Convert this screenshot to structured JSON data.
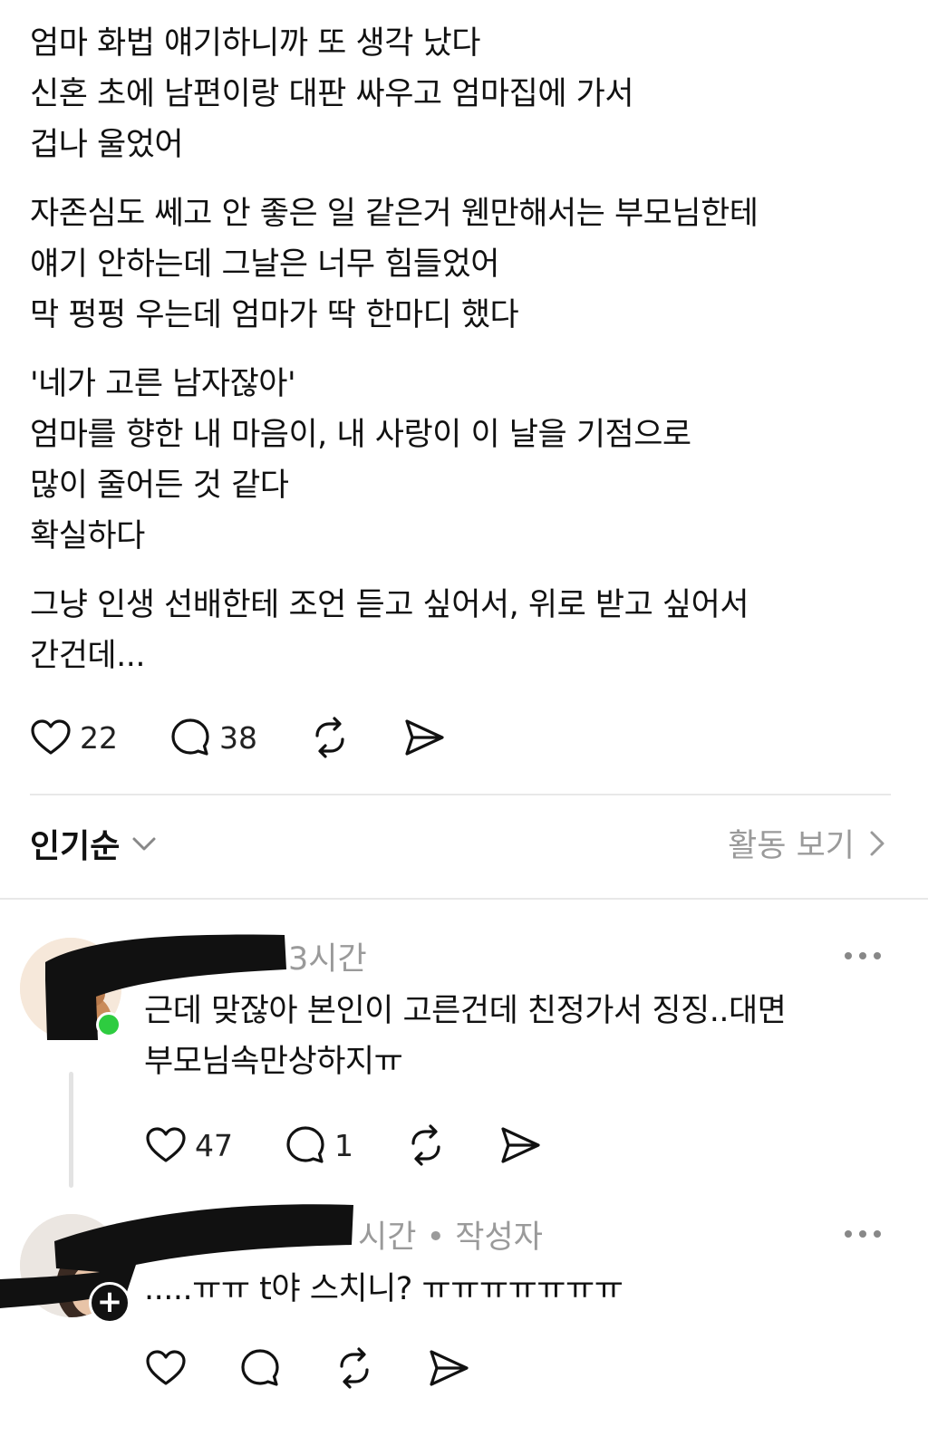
{
  "post": {
    "paragraphs": [
      [
        "엄마 화법 얘기하니까 또 생각 났다",
        "신혼 초에 남편이랑 대판 싸우고 엄마집에 가서",
        "겁나 울었어"
      ],
      [
        "자존심도 쎄고 안 좋은 일 같은거 웬만해서는 부모님한테",
        "얘기 안하는데 그날은 너무 힘들었어",
        "막 펑펑 우는데 엄마가 딱 한마디 했다"
      ],
      [
        "'네가 고른 남자잖아'",
        "엄마를 향한 내 마음이, 내 사랑이 이 날을 기점으로",
        "많이 줄어든 것 같다",
        "확실하다"
      ],
      [
        "그냥 인생 선배한테 조언 듣고 싶어서, 위로 받고 싶어서",
        "간건데..."
      ]
    ],
    "actions": {
      "like_count": "22",
      "comment_count": "38"
    }
  },
  "sort": {
    "label": "인기순",
    "activity_label": "활동 보기"
  },
  "comments": [
    {
      "time": "3시간",
      "text_lines": [
        "근데 맞잖아 본인이 고른건데 친정가서 징징..대면",
        "부모님속만상하지ㅠ"
      ],
      "like_count": "47",
      "reply_count": "1"
    },
    {
      "meta": "시간 • 작성자",
      "text_lines": [
        ".....ㅠㅠ t야 스치니? ㅠㅠㅠㅠㅠㅠㅠ"
      ],
      "like_count": "",
      "reply_count": ""
    }
  ],
  "icons": [
    "heart-icon",
    "comment-icon",
    "repost-icon",
    "send-icon",
    "chevron-down-icon",
    "chevron-right-icon",
    "more-icon",
    "plus-icon"
  ],
  "colors": {
    "online": "#2ecc40",
    "muted": "#9a9a9a",
    "redaction": "#111111"
  }
}
